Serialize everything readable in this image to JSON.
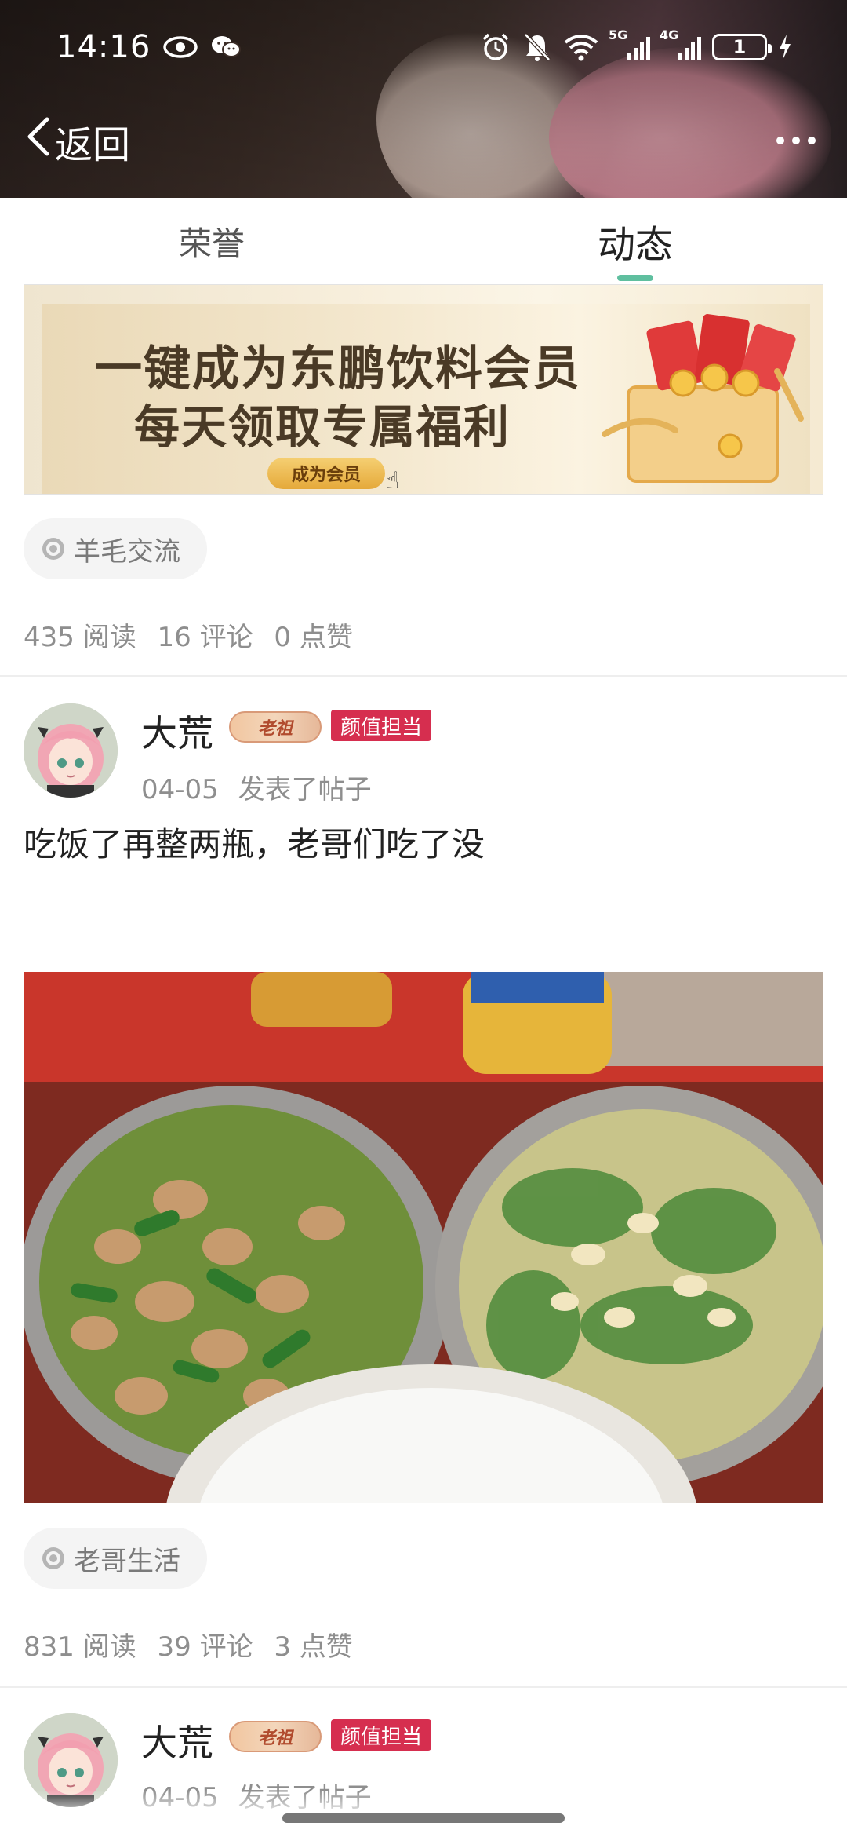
{
  "status_bar": {
    "time": "14:16",
    "battery_level": "1",
    "network_labels": [
      "5G",
      "4G"
    ]
  },
  "nav": {
    "back_label": "返回"
  },
  "tabs": [
    {
      "label": "荣誉",
      "active": false
    },
    {
      "label": "动态",
      "active": true
    }
  ],
  "banner": {
    "line1": "一键成为东鹏饮料会员",
    "line2": "每天领取专属福利",
    "cta": "成为会员"
  },
  "posts": [
    {
      "topic": "羊毛交流",
      "stats": {
        "reads": "435 阅读",
        "comments": "16 评论",
        "likes": "0 点赞"
      }
    },
    {
      "username": "大荒",
      "level_badge": "老祖",
      "title_badge": "颜值担当",
      "date": "04-05",
      "action": "发表了帖子",
      "text": "吃饭了再整两瓶，老哥们吃了没",
      "topic": "老哥生活",
      "stats": {
        "reads": "831 阅读",
        "comments": "39 评论",
        "likes": "3 点赞"
      }
    },
    {
      "username": "大荒",
      "level_badge": "老祖",
      "title_badge": "颜值担当",
      "date": "04-05",
      "action": "发表了帖子"
    }
  ],
  "colors": {
    "accent": "#5fbf9f",
    "title_badge_bg": "#d62e4f",
    "muted_text": "#8e8e8e"
  }
}
